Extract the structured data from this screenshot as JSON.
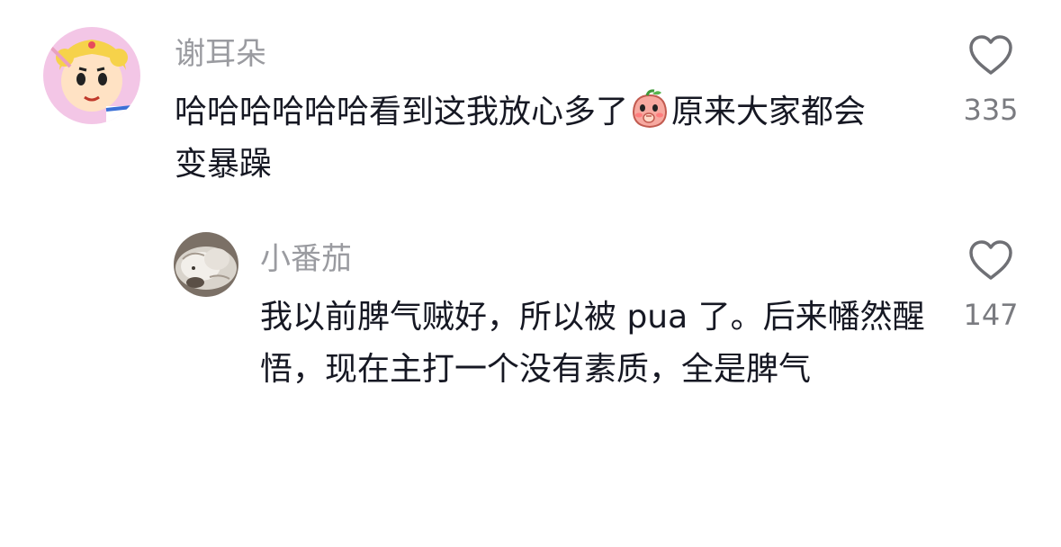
{
  "comments": [
    {
      "username": "谢耳朵",
      "text_before_emoji": "哈哈哈哈哈哈看到这我放心多了",
      "emoji_name": "shy-peach-emoji",
      "text_after_emoji": "原来大家都会变暴躁",
      "like_count": "335",
      "like_icon": "heart-outline-icon",
      "avatar": "sailor-moon-crayon-shin-avatar"
    },
    {
      "username": "小番茄",
      "text": "我以前脾气贼好，所以被 pua 了。后来幡然醒悟，现在主打一个没有素质，全是脾气",
      "like_count": "147",
      "like_icon": "heart-outline-icon",
      "avatar": "fluffy-cat-avatar"
    }
  ],
  "colors": {
    "username": "#9a9ba0",
    "text": "#161823",
    "count": "#7a7b80",
    "background": "#ffffff"
  }
}
